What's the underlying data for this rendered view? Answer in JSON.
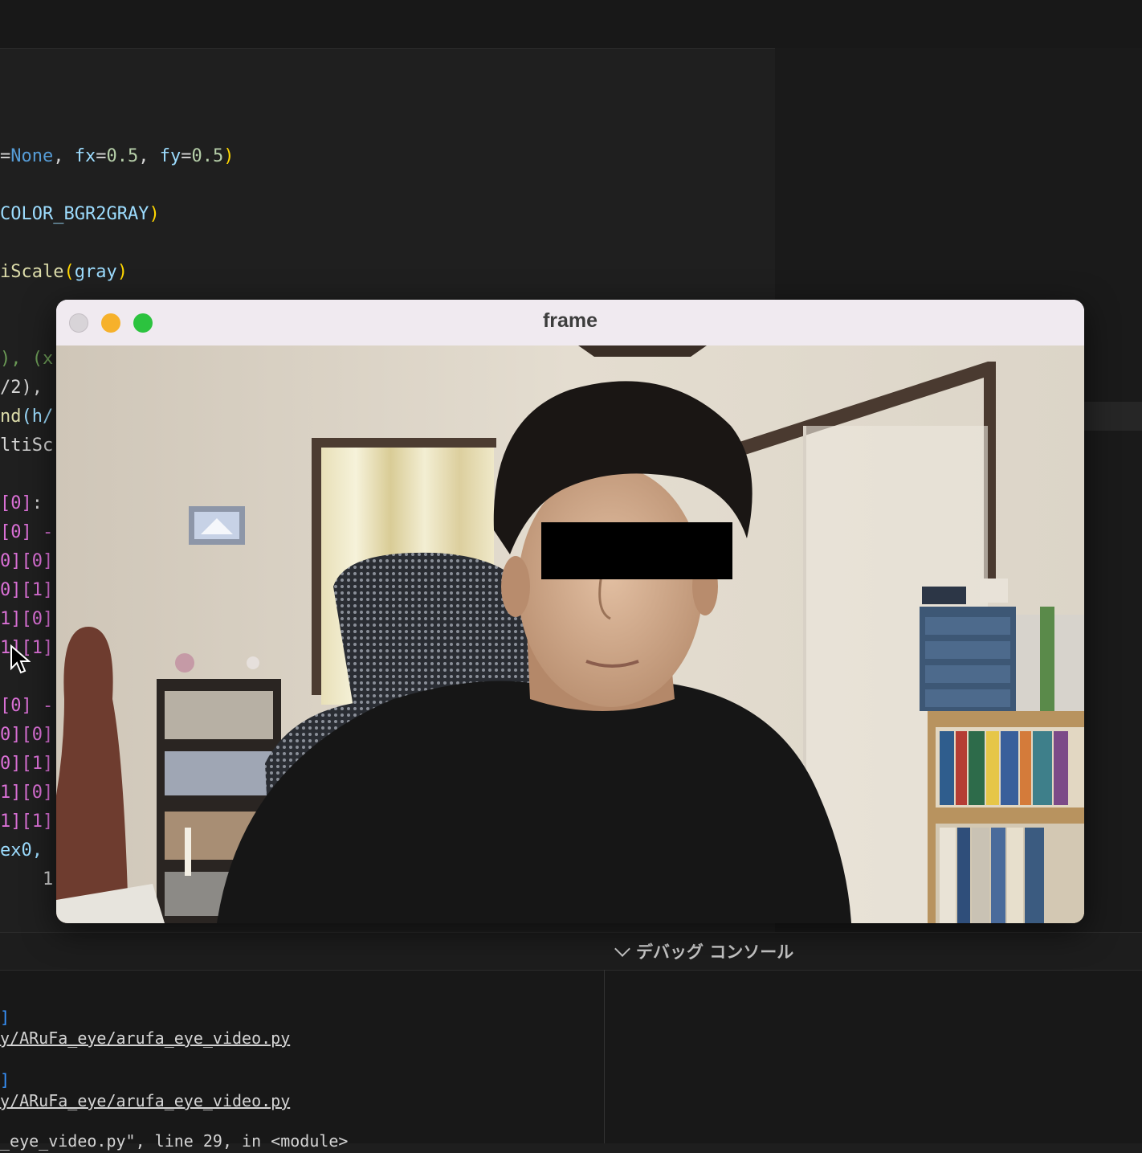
{
  "editor": {
    "code_lines": [
      [
        {
          "t": "=",
          "c": ""
        },
        {
          "t": "None",
          "c": "kw"
        },
        {
          "t": ", ",
          "c": ""
        },
        {
          "t": "fx",
          "c": "prm"
        },
        {
          "t": "=",
          "c": ""
        },
        {
          "t": "0.5",
          "c": "num"
        },
        {
          "t": ", ",
          "c": ""
        },
        {
          "t": "fy",
          "c": "prm"
        },
        {
          "t": "=",
          "c": ""
        },
        {
          "t": "0.5",
          "c": "num"
        },
        {
          "t": ")",
          "c": "br"
        }
      ],
      [
        {
          "t": "COLOR_BGR2GRAY",
          "c": "cls"
        },
        {
          "t": ")",
          "c": "br"
        }
      ],
      [
        {
          "t": "iScale",
          "c": "fn"
        },
        {
          "t": "(",
          "c": "br"
        },
        {
          "t": "gray",
          "c": "prm"
        },
        {
          "t": ")",
          "c": "br"
        }
      ],
      [
        {
          "t": "), (x",
          "c": "grn"
        }
      ],
      [
        {
          "t": "/2), ",
          "c": ""
        }
      ],
      [
        {
          "t": "nd",
          "c": "fn"
        },
        {
          "t": "(h/",
          "c": "prm"
        }
      ],
      [
        {
          "t": "ltiSc",
          "c": ""
        }
      ],
      [
        {
          "t": "[0]",
          "c": "brp"
        },
        {
          "t": ":",
          "c": ""
        }
      ],
      [
        {
          "t": "[0] -",
          "c": "brp"
        }
      ],
      [
        {
          "t": "0][0]",
          "c": "brp"
        }
      ],
      [
        {
          "t": "0][1]",
          "c": "brp"
        }
      ],
      [
        {
          "t": "1][0]",
          "c": "brp"
        }
      ],
      [
        {
          "t": "1][1]",
          "c": "brp"
        }
      ],
      [
        {
          "t": "[0] -",
          "c": "brp"
        }
      ],
      [
        {
          "t": "0][0]",
          "c": "brp"
        }
      ],
      [
        {
          "t": "0][1]",
          "c": "brp"
        }
      ],
      [
        {
          "t": "1][0]",
          "c": "brp"
        }
      ],
      [
        {
          "t": "1][1]",
          "c": "brp"
        }
      ],
      [
        {
          "t": "ex0, ",
          "c": "prm"
        }
      ],
      [
        {
          "t": "    1)",
          "c": ""
        }
      ]
    ]
  },
  "panel": {
    "debug_console_label": "デバッグ コンソール",
    "terminal_lines": [
      {
        "text": "]",
        "kind": "bracket"
      },
      {
        "text": "y/ARuFa_eye/arufa_eye_video.py",
        "kind": "link"
      },
      {
        "text": "",
        "kind": "plain"
      },
      {
        "text": "]",
        "kind": "bracket"
      },
      {
        "text": "y/ARuFa_eye/arufa_eye_video.py",
        "kind": "link"
      },
      {
        "text": "",
        "kind": "plain"
      },
      {
        "text": "_eye_video.py\", line 29, in <module>",
        "kind": "plain"
      }
    ]
  },
  "window": {
    "title": "frame"
  }
}
